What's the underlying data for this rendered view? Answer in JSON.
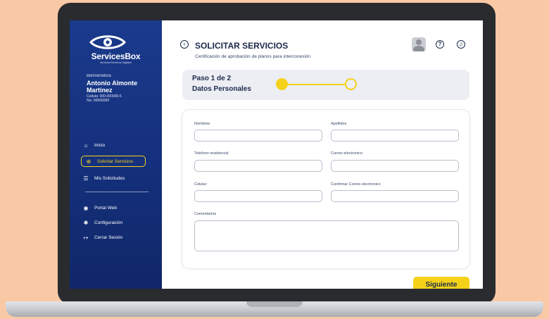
{
  "brand": {
    "name": "ServicesBox",
    "tagline": "Servicios Electricos Digitales"
  },
  "user": {
    "welcome": "Bienvenido/a",
    "name": "Antonio Almonte Martinez",
    "cedula": "Cedula: 000-000000-5",
    "nic": "Nic: 66566990"
  },
  "sidebar": {
    "primary": [
      {
        "label": "Inicio",
        "icon": "home-icon",
        "glyph": "⌂"
      },
      {
        "label": "Solicitar Servicios",
        "icon": "plus-circle-icon",
        "glyph": "⊕"
      },
      {
        "label": "Mis Solicitudes",
        "icon": "list-icon",
        "glyph": "☰"
      }
    ],
    "secondary": [
      {
        "label": "Portal Web",
        "icon": "globe-icon",
        "glyph": "◉"
      },
      {
        "label": "Configuración",
        "icon": "gear-icon",
        "glyph": "✱"
      },
      {
        "label": "Cerrar Sesión",
        "icon": "logout-icon",
        "glyph": "↦"
      }
    ]
  },
  "header": {
    "title": "SOLICITAR SERVICIOS",
    "subtitle": "Certificación de aprobación de planos para interconexión",
    "back_glyph": "‹",
    "help_glyph": "?",
    "bell_glyph": "♫"
  },
  "stepper": {
    "step": "Paso 1 de 2",
    "name": "Datos Personales",
    "current": 1,
    "total": 2
  },
  "form": {
    "nombres_label": "Nombres",
    "apellidos_label": "Apellidos",
    "telefono_label": "Telefono residencial",
    "correo_label": "Correo electronico",
    "celular_label": "Celular",
    "confirmar_label": "Confirmar Correo electronico",
    "comentarios_label": "Comentarios"
  },
  "actions": {
    "next_label": "Siguiente"
  },
  "colors": {
    "accent": "#f4d21a",
    "sidebar": "#1b3a8c",
    "background": "#f9c9a6",
    "text": "#1c2a4a"
  }
}
